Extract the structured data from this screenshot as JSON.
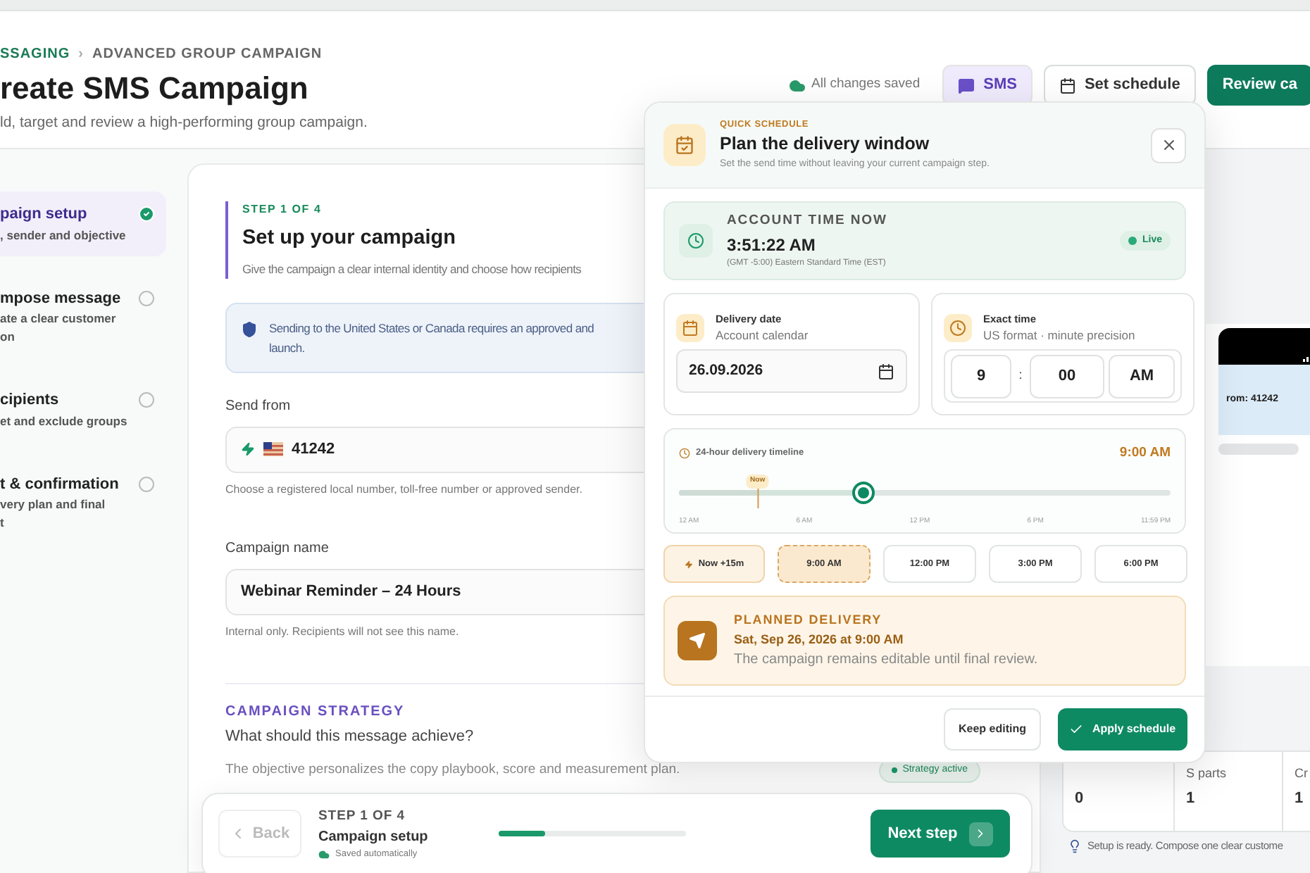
{
  "header": {
    "breadcrumb": [
      "SSAGING",
      "ADVANCED GROUP CAMPAIGN"
    ],
    "separator": "›",
    "title": "reate SMS Campaign",
    "subtitle": "ld, target and review a high-performing group campaign.",
    "save_status": "All changes saved",
    "actions": [
      {
        "label": "SMS",
        "kind": "channel"
      },
      {
        "label": "Set schedule",
        "kind": "schedule"
      },
      {
        "label": "Review ca",
        "kind": "primary"
      }
    ]
  },
  "steps": [
    {
      "title": "paign setup",
      "subtitle_lines": [
        ", sender and objective"
      ],
      "selected": true,
      "done": true
    },
    {
      "title": "mpose message",
      "subtitle_lines": [
        "ate a clear customer",
        "on"
      ],
      "selected": false,
      "done": false
    },
    {
      "title": "cipients",
      "subtitle_lines": [
        "et and exclude groups"
      ],
      "selected": false,
      "done": false
    },
    {
      "title": "t & confirmation",
      "subtitle_lines": [
        "very plan and final",
        "t"
      ],
      "selected": false,
      "done": false
    }
  ],
  "setup": {
    "eyebrow": "STEP 1 OF 4",
    "title": "Set up your campaign",
    "description": "Give the campaign a clear internal identity and choose how recipients",
    "notice_lines": [
      "Sending to the United States or Canada requires an approved and",
      "launch."
    ],
    "fields": [
      {
        "label": "Send from",
        "value": "41242",
        "help": "Choose a registered local number, toll-free number or approved sender.",
        "kind": "sender"
      },
      {
        "label": "Campaign name",
        "value": "Webinar Reminder – 24 Hours",
        "help": "Internal only. Recipients will not see this name.",
        "kind": "text"
      }
    ],
    "strategy": {
      "heading": "CAMPAIGN STRATEGY",
      "question": "What should this message achieve?",
      "note": "The objective personalizes the copy playbook, score and measurement plan.",
      "badge": "Strategy active"
    }
  },
  "preview": {
    "sender": "rom: 41242"
  },
  "stats": [
    {
      "value": "0"
    },
    {
      "label": "S parts",
      "value": "1"
    },
    {
      "label": "Cr",
      "value": "1"
    }
  ],
  "tip": "Setup is ready. Compose one clear custome",
  "schedule_popup": {
    "eyebrow": "QUICK SCHEDULE",
    "title": "Plan the delivery window",
    "subtitle": "Set the send time without leaving your current campaign step.",
    "account_time": {
      "label": "ACCOUNT TIME NOW",
      "time": "3:51:22 AM",
      "zone": "(GMT -5:00) Eastern Standard Time (EST)",
      "status": "Live",
      "live": true
    },
    "date": {
      "label": "Delivery date",
      "hint": "Account calendar",
      "value": "26.09.2026"
    },
    "time": {
      "label": "Exact time",
      "hint": "US format · minute precision",
      "hour": "9",
      "separator": ":",
      "minute": "00",
      "period": "AM"
    },
    "timeline": {
      "label": "24-hour delivery timeline",
      "reading": "9:00 AM",
      "level": 0.375,
      "now": {
        "label": "Now",
        "level": 0.16
      },
      "ticks": [
        "12 AM",
        "6 AM",
        "12 PM",
        "6 PM",
        "11:59 PM"
      ]
    },
    "presets": [
      {
        "label": "Now +15m",
        "kind": "now",
        "selected": false
      },
      {
        "label": "9:00 AM",
        "kind": "time",
        "selected": true
      },
      {
        "label": "12:00 PM",
        "kind": "time",
        "selected": false
      },
      {
        "label": "3:00 PM",
        "kind": "time",
        "selected": false
      },
      {
        "label": "6:00 PM",
        "kind": "time",
        "selected": false
      }
    ],
    "planned": {
      "heading": "PLANNED DELIVERY",
      "when": "Sat, Sep 26, 2026 at 9:00 AM",
      "note": "The campaign remains editable until final review."
    },
    "buttons": [
      {
        "label": "Keep editing",
        "kind": "secondary"
      },
      {
        "label": "Apply schedule",
        "kind": "primary"
      }
    ]
  },
  "footer_bar": {
    "back": "Back",
    "back_disabled": true,
    "step": "STEP 1 OF 4",
    "step_name": "Campaign setup",
    "saved": "Saved automatically",
    "level": 0.25,
    "next": "Next step"
  }
}
